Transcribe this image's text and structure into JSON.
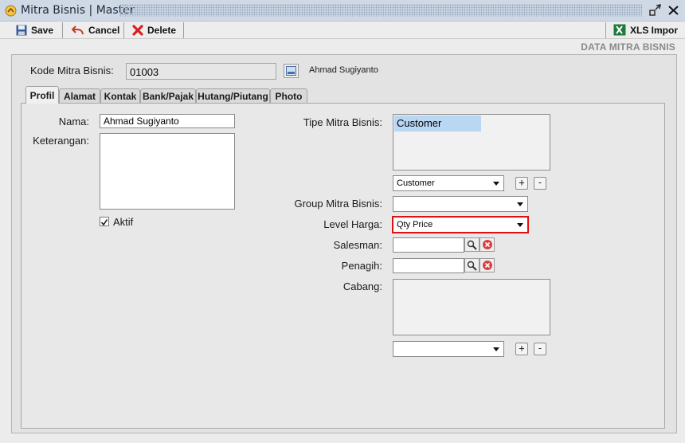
{
  "window": {
    "title": "Mitra Bisnis | Master"
  },
  "toolbar": {
    "save_label": "Save",
    "cancel_label": "Cancel",
    "delete_label": "Delete",
    "import_label": "XLS Impor"
  },
  "section_title": "DATA MITRA BISNIS",
  "header": {
    "kode_label": "Kode Mitra Bisnis:",
    "kode_value": "01003",
    "name_display": "Ahmad Sugiyanto"
  },
  "tabs": [
    {
      "label": "Profil",
      "active": true
    },
    {
      "label": "Alamat",
      "active": false
    },
    {
      "label": "Kontak",
      "active": false
    },
    {
      "label": "Bank/Pajak",
      "active": false
    },
    {
      "label": "Hutang/Piutang",
      "active": false
    },
    {
      "label": "Photo",
      "active": false
    }
  ],
  "form": {
    "nama_label": "Nama:",
    "nama_value": "Ahmad Sugiyanto",
    "keterangan_label": "Keterangan:",
    "keterangan_value": "",
    "aktif_label": "Aktif",
    "aktif_checked": true,
    "tipe_label": "Tipe Mitra Bisnis:",
    "tipe_list": [
      "Customer"
    ],
    "tipe_select": "Customer",
    "group_label": "Group Mitra Bisnis:",
    "group_select": "",
    "level_label": "Level Harga:",
    "level_select": "Qty Price",
    "salesman_label": "Salesman:",
    "salesman_value": "",
    "penagih_label": "Penagih:",
    "penagih_value": "",
    "cabang_label": "Cabang:",
    "cabang_select": "",
    "plus": "+",
    "minus": "-"
  },
  "colors": {
    "highlight_border": "#e01010",
    "list_selection": "#b9d6f3",
    "delete_icon": "#d82020",
    "clear_icon": "#d84040"
  }
}
